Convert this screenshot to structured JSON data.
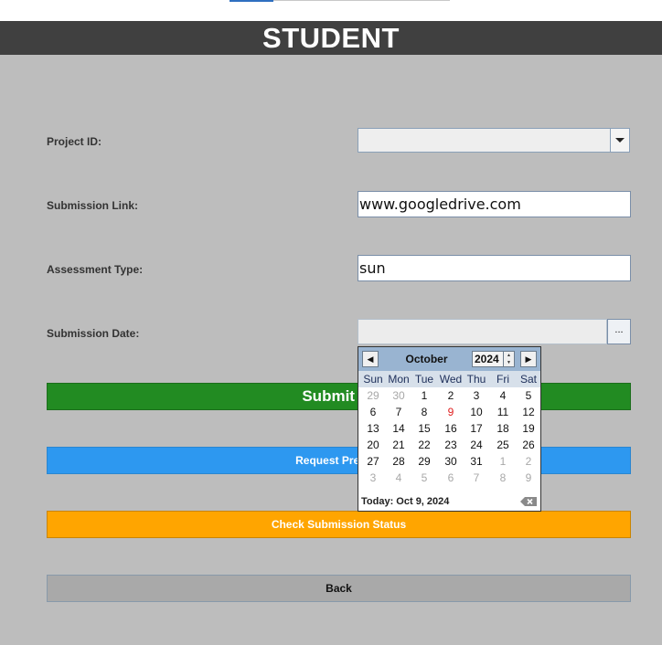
{
  "header": {
    "title": "STUDENT"
  },
  "form": {
    "project_id": {
      "label": "Project ID:",
      "value": ""
    },
    "submission_link": {
      "label": "Submission Link:",
      "value": "www.googledrive.com"
    },
    "assessment_type": {
      "label": "Assessment Type:",
      "value": "sun"
    },
    "submission_date": {
      "label": "Submission Date:",
      "value": "",
      "picker_button": "..."
    }
  },
  "buttons": {
    "submit": "Submit Pr",
    "request": "Request Present",
    "check": "Check Submission Status",
    "back": "Back"
  },
  "calendar": {
    "month": "October",
    "year": "2024",
    "prev_glyph": "◀",
    "next_glyph": "▶",
    "weekdays": [
      "Sun",
      "Mon",
      "Tue",
      "Wed",
      "Thu",
      "Fri",
      "Sat"
    ],
    "weeks": [
      [
        {
          "d": "29",
          "o": true
        },
        {
          "d": "30",
          "o": true
        },
        {
          "d": "1"
        },
        {
          "d": "2"
        },
        {
          "d": "3"
        },
        {
          "d": "4"
        },
        {
          "d": "5"
        }
      ],
      [
        {
          "d": "6"
        },
        {
          "d": "7"
        },
        {
          "d": "8"
        },
        {
          "d": "9",
          "today": true
        },
        {
          "d": "10"
        },
        {
          "d": "11"
        },
        {
          "d": "12"
        }
      ],
      [
        {
          "d": "13"
        },
        {
          "d": "14"
        },
        {
          "d": "15"
        },
        {
          "d": "16"
        },
        {
          "d": "17"
        },
        {
          "d": "18"
        },
        {
          "d": "19"
        }
      ],
      [
        {
          "d": "20"
        },
        {
          "d": "21"
        },
        {
          "d": "22"
        },
        {
          "d": "23"
        },
        {
          "d": "24"
        },
        {
          "d": "25"
        },
        {
          "d": "26"
        }
      ],
      [
        {
          "d": "27"
        },
        {
          "d": "28"
        },
        {
          "d": "29"
        },
        {
          "d": "30"
        },
        {
          "d": "31"
        },
        {
          "d": "1",
          "o": true
        },
        {
          "d": "2",
          "o": true
        }
      ],
      [
        {
          "d": "3",
          "o": true
        },
        {
          "d": "4",
          "o": true
        },
        {
          "d": "5",
          "o": true
        },
        {
          "d": "6",
          "o": true
        },
        {
          "d": "7",
          "o": true
        },
        {
          "d": "8",
          "o": true
        },
        {
          "d": "9",
          "o": true
        }
      ]
    ],
    "today_text": "Today: Oct 9, 2024",
    "clear_icon": "backspace-x-icon"
  },
  "colors": {
    "background": "#bdbdbd",
    "header_bg": "#404040",
    "submit_green": "#228b22",
    "request_blue": "#2d98f0",
    "check_orange": "#ffa500",
    "back_gray": "#a9a9a9",
    "calendar_head": "#99b4d1",
    "today_red": "#e02020"
  }
}
